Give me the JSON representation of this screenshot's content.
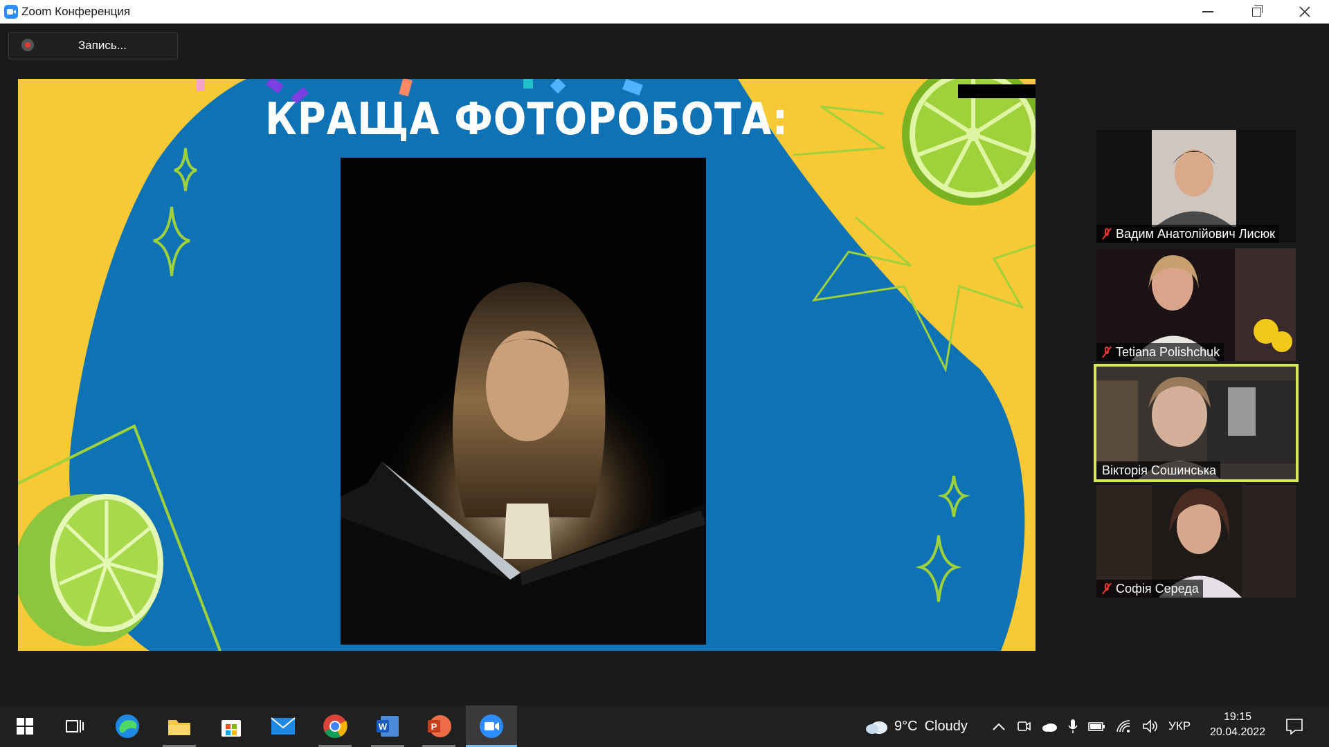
{
  "window": {
    "title": "Zoom Конференция"
  },
  "recording": {
    "label": "Запись..."
  },
  "slide": {
    "title": "КРАЩА ФОТОРОБОТА:"
  },
  "participants": [
    {
      "name": "Вадим Анатолійович Лисюк",
      "muted": true,
      "active": false
    },
    {
      "name": "Tetiana Polishchuk",
      "muted": true,
      "active": false
    },
    {
      "name": "Вікторія Сошинська",
      "muted": false,
      "active": true
    },
    {
      "name": "Софія Середа",
      "muted": true,
      "active": false
    }
  ],
  "taskbar": {
    "apps": [
      "start-icon",
      "task-view-icon",
      "edge-icon",
      "file-explorer-icon",
      "microsoft-store-icon",
      "mail-icon",
      "chrome-icon",
      "word-icon",
      "powerpoint-icon",
      "zoom-icon"
    ],
    "weather": {
      "temp": "9°C",
      "condition": "Cloudy"
    },
    "language": "УКР",
    "time": "19:15",
    "date": "20.04.2022"
  },
  "colors": {
    "slide_yellow": "#f6c935",
    "slide_blue": "#0f72b4",
    "active_speaker": "#d6e85a",
    "lime": "#9fd13b"
  }
}
